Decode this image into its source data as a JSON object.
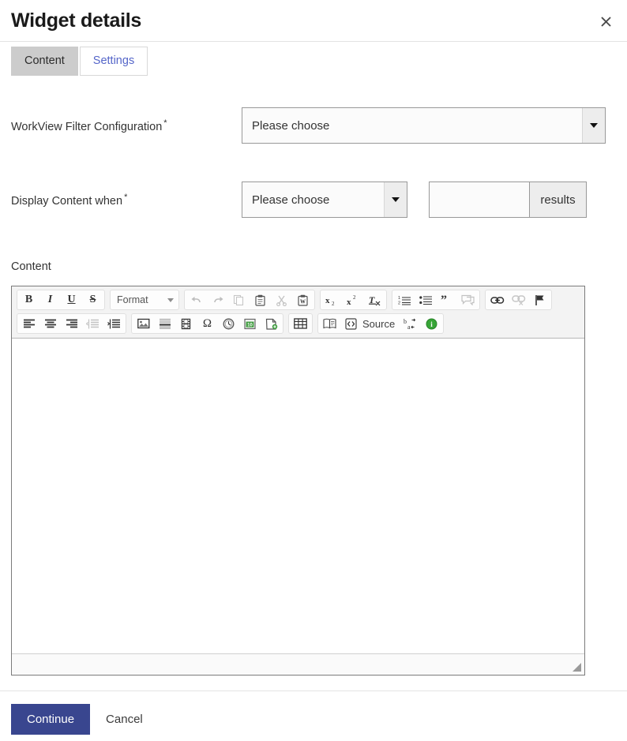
{
  "dialog": {
    "title": "Widget details",
    "close_icon": "close-icon"
  },
  "tabs": [
    {
      "label": "Content",
      "active": true
    },
    {
      "label": "Settings",
      "active": false
    }
  ],
  "fields": {
    "filter": {
      "label": "WorkView Filter Configuration",
      "required_marker": "*",
      "select_value": "Please choose"
    },
    "display_when": {
      "label": "Display Content when",
      "required_marker": "*",
      "select_value": "Please choose",
      "count_value": "",
      "count_placeholder": "",
      "suffix": "results"
    },
    "content": {
      "label": "Content",
      "editor_body": ""
    }
  },
  "editor": {
    "toolbar_rows": [
      {
        "groups": [
          {
            "name": "basic-styles",
            "buttons": [
              {
                "name": "bold-icon",
                "glyph": "B",
                "disabled": false
              },
              {
                "name": "italic-icon",
                "glyph": "I",
                "disabled": false
              },
              {
                "name": "underline-icon",
                "glyph": "U",
                "disabled": false
              },
              {
                "name": "strikethrough-icon",
                "glyph": "S",
                "disabled": false
              }
            ]
          },
          {
            "name": "format-combo",
            "combo_label": "Format"
          },
          {
            "name": "clipboard-undo",
            "buttons": [
              {
                "name": "undo-icon",
                "disabled": true
              },
              {
                "name": "redo-icon",
                "disabled": true
              },
              {
                "name": "copy-icon",
                "disabled": true
              },
              {
                "name": "paste-icon",
                "disabled": false
              },
              {
                "name": "cut-icon",
                "disabled": true
              },
              {
                "name": "paste-from-word-icon",
                "disabled": false
              }
            ]
          },
          {
            "name": "script-styles",
            "buttons": [
              {
                "name": "subscript-icon",
                "disabled": false
              },
              {
                "name": "superscript-icon",
                "disabled": false
              },
              {
                "name": "remove-format-icon",
                "disabled": false
              }
            ]
          },
          {
            "name": "lists-quote",
            "buttons": [
              {
                "name": "numbered-list-icon",
                "disabled": false
              },
              {
                "name": "bulleted-list-icon",
                "disabled": false
              },
              {
                "name": "block-quote-icon",
                "disabled": false
              },
              {
                "name": "comment-icon",
                "disabled": true
              }
            ]
          },
          {
            "name": "links",
            "buttons": [
              {
                "name": "link-icon",
                "disabled": false
              },
              {
                "name": "unlink-icon",
                "disabled": true
              },
              {
                "name": "anchor-flag-icon",
                "disabled": false
              }
            ]
          }
        ]
      },
      {
        "groups": [
          {
            "name": "paragraph-align",
            "buttons": [
              {
                "name": "align-left-icon",
                "disabled": false
              },
              {
                "name": "align-center-icon",
                "disabled": false
              },
              {
                "name": "align-right-icon",
                "disabled": false
              },
              {
                "name": "outdent-icon",
                "disabled": true
              },
              {
                "name": "indent-icon",
                "disabled": false
              }
            ]
          },
          {
            "name": "insert",
            "buttons": [
              {
                "name": "image-icon",
                "disabled": false
              },
              {
                "name": "horizontal-rule-icon",
                "disabled": false
              },
              {
                "name": "flash-video-icon",
                "disabled": false
              },
              {
                "name": "special-character-icon",
                "glyph": "Ω",
                "disabled": false
              },
              {
                "name": "clock-time-icon",
                "disabled": false
              },
              {
                "name": "calendar-date-icon",
                "disabled": false
              },
              {
                "name": "page-break-icon",
                "disabled": false
              }
            ]
          },
          {
            "name": "table-group",
            "buttons": [
              {
                "name": "table-icon",
                "disabled": false
              }
            ]
          },
          {
            "name": "tools",
            "buttons": [
              {
                "name": "templates-icon",
                "disabled": false
              },
              {
                "name": "source-icon",
                "disabled": false
              },
              {
                "name": "text-direction-icon",
                "disabled": false
              },
              {
                "name": "about-info-icon",
                "disabled": false
              }
            ],
            "source_label": "Source"
          }
        ]
      }
    ],
    "resize_grip": "resize-handle-icon"
  },
  "footer": {
    "continue_label": "Continue",
    "cancel_label": "Cancel"
  },
  "colors": {
    "primary_button": "#39468f",
    "active_tab": "#cccccc",
    "link_tab": "#5566c9"
  }
}
